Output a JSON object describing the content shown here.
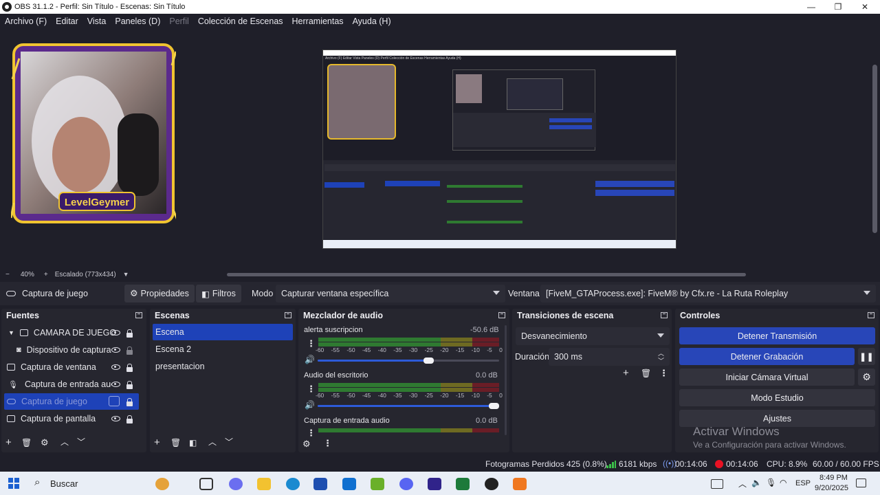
{
  "window": {
    "title": "OBS 31.1.2 - Perfil: Sin Título - Escenas: Sin Título",
    "minimize": "—",
    "maximize": "❐",
    "close": "✕"
  },
  "menu": {
    "items": [
      "Archivo (F)",
      "Editar",
      "Vista",
      "Paneles (D)",
      "Perfil",
      "Colección de Escenas",
      "Herramientas",
      "Ayuda (H)"
    ]
  },
  "preview": {
    "overlay_text": "LevelGeymer",
    "nested_menu": "Archivo (F)  Editar  Vista  Paneles (D)  Perfil  Colección de Escenas  Herramientas  Ayuda (H)"
  },
  "zoom": {
    "minus": "−",
    "value": "40%",
    "plus": "+",
    "scaling": "Escalado (773x434)"
  },
  "source_bar": {
    "source_name": "Captura de juego",
    "properties": "Propiedades",
    "filters": "Filtros",
    "mode_label": "Modo",
    "mode_value": "Capturar ventana específica",
    "window_label": "Ventana",
    "window_value": "[FiveM_GTAProcess.exe]: FiveM® by Cfx.re - La Ruta Roleplay"
  },
  "sources": {
    "title": "Fuentes",
    "items": [
      {
        "label": "CAMARA DE JUEGO"
      },
      {
        "label": "Dispositivo de captura"
      },
      {
        "label": "Captura de ventana"
      },
      {
        "label": "Captura de entrada audio"
      },
      {
        "label": "Captura de juego"
      },
      {
        "label": "Captura de pantalla"
      }
    ]
  },
  "scenes": {
    "title": "Escenas",
    "items": [
      "Escena",
      "Escena 2",
      "presentacion"
    ]
  },
  "mixer": {
    "title": "Mezclador de audio",
    "channels": [
      {
        "name": "alerta suscripcion",
        "db": "-50.6 dB",
        "volume": 0.62
      },
      {
        "name": "Audio del escritorio",
        "db": "0.0 dB",
        "volume": 1.0
      },
      {
        "name": "Captura de entrada audio",
        "db": "0.0 dB",
        "volume": 1.0
      }
    ],
    "scale": [
      "-60",
      "-55",
      "-50",
      "-45",
      "-40",
      "-35",
      "-30",
      "-25",
      "-20",
      "-15",
      "-10",
      "-5",
      "0"
    ]
  },
  "transitions": {
    "title": "Transiciones de escena",
    "type": "Desvanecimiento",
    "duration_label": "Duración",
    "duration_value": "300 ms"
  },
  "controls": {
    "title": "Controles",
    "stop_stream": "Detener Transmisión",
    "stop_record": "Detener Grabación",
    "virtual_cam": "Iniciar Cámara Virtual",
    "studio_mode": "Modo Estudio",
    "settings": "Ajustes"
  },
  "watermark": {
    "line1": "Activar Windows",
    "line2": "Ve a Configuración para activar Windows."
  },
  "status": {
    "dropped": "Fotogramas Perdidos 425 (0.8%)",
    "bitrate": "6181 kbps",
    "stream_time": "00:14:06",
    "rec_time": "00:14:06",
    "cpu": "CPU: 8.9%",
    "fps": "60.00 / 60.00 FPS"
  },
  "taskbar": {
    "search": "Buscar",
    "lang": "ESP",
    "time": "8:49 PM",
    "date": "9/20/2025"
  },
  "colors": {
    "accent": "#2846b8",
    "record": "#e81123",
    "meter_green": "#2f7a31"
  }
}
